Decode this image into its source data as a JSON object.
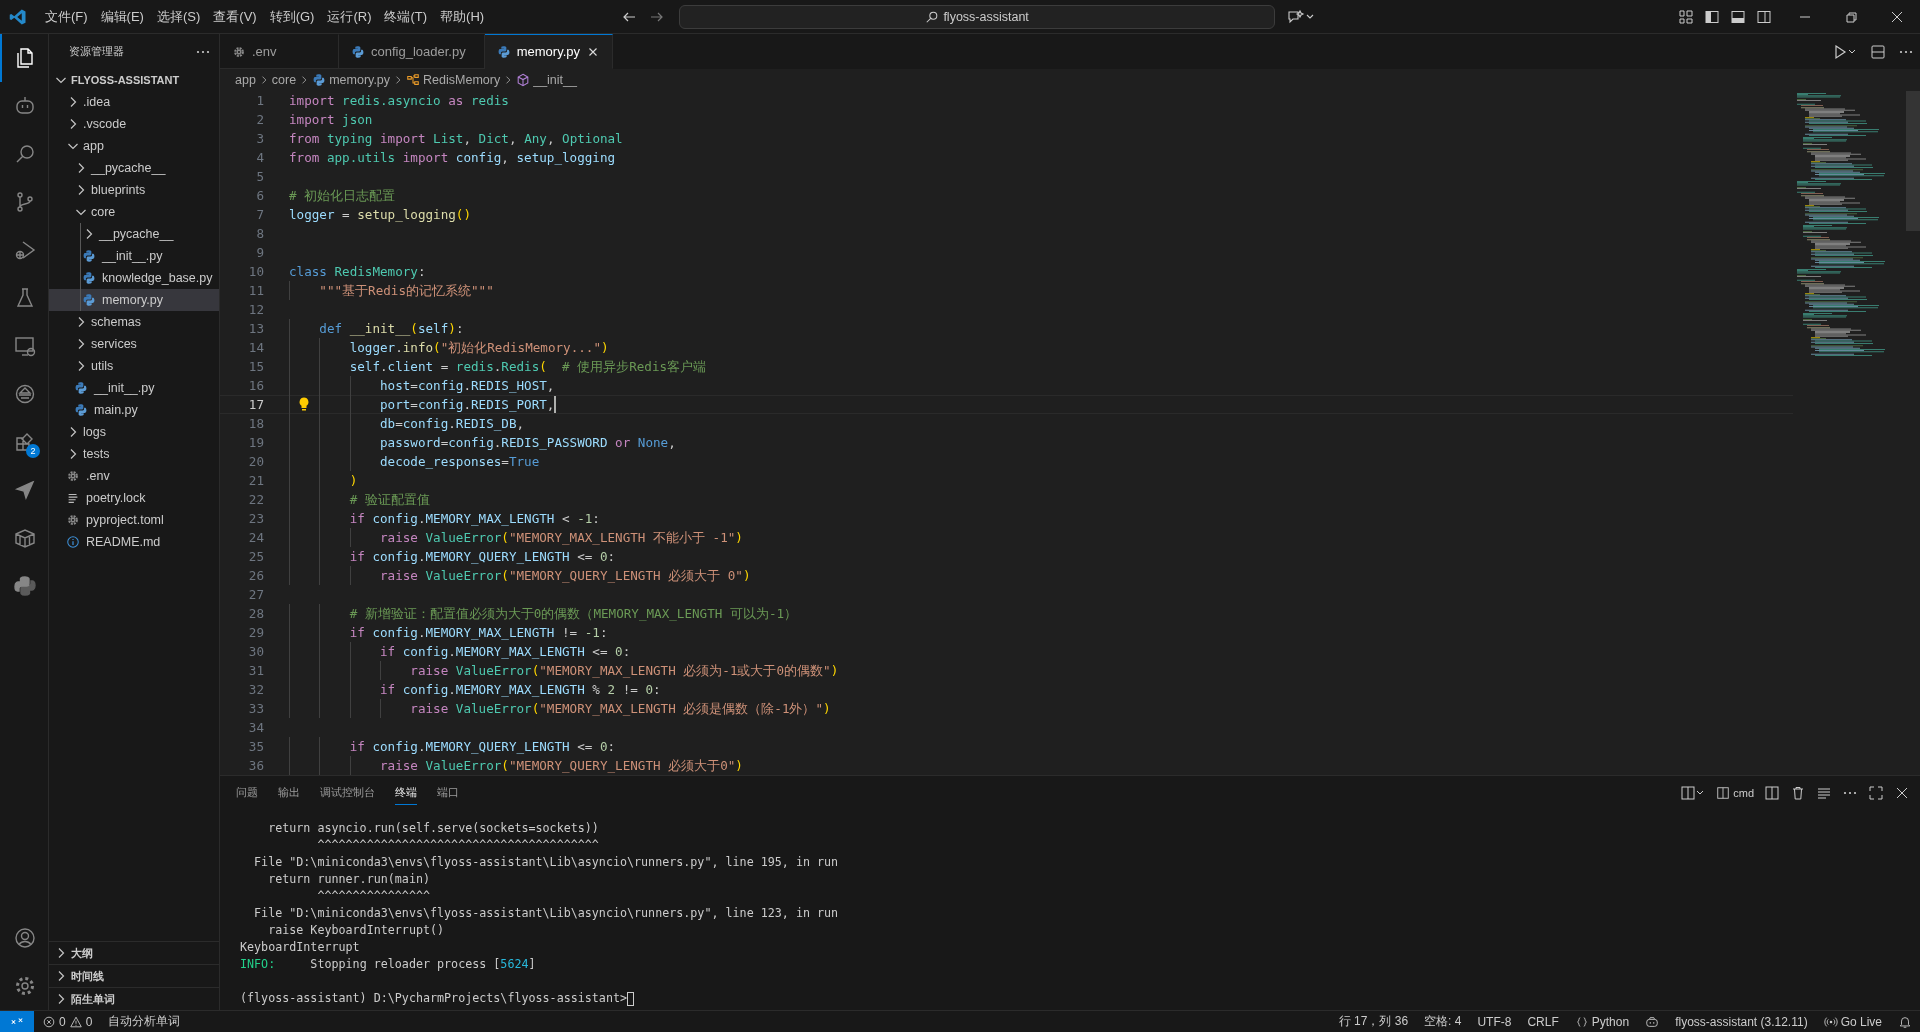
{
  "title_bar": {
    "menus": [
      "文件(F)",
      "编辑(E)",
      "选择(S)",
      "查看(V)",
      "转到(G)",
      "运行(R)",
      "终端(T)",
      "帮助(H)"
    ],
    "command_center": "flyoss-assistant"
  },
  "activity_bar": {
    "items": [
      {
        "kind": "files",
        "selected": true
      },
      {
        "kind": "robot",
        "selected": false
      },
      {
        "kind": "search",
        "selected": false
      },
      {
        "kind": "branch",
        "selected": false
      },
      {
        "kind": "debug",
        "selected": false
      },
      {
        "kind": "flask",
        "selected": false
      },
      {
        "kind": "monitor",
        "selected": false
      },
      {
        "kind": "dome",
        "selected": false
      },
      {
        "kind": "extensions",
        "selected": false,
        "badge": "2"
      },
      {
        "kind": "send",
        "selected": false
      },
      {
        "kind": "box",
        "selected": false
      },
      {
        "kind": "python",
        "selected": false
      }
    ],
    "bottom": [
      {
        "kind": "account",
        "selected": false
      },
      {
        "kind": "settings",
        "selected": false
      }
    ]
  },
  "sidebar": {
    "title": "资源管理器",
    "root": "FLYOSS-ASSISTANT",
    "items": [
      {
        "name": ".idea",
        "kind": "folder",
        "expanded": false,
        "selected": false
      },
      {
        "name": ".vscode",
        "kind": "folder",
        "expanded": false,
        "selected": false
      },
      {
        "name": "app",
        "kind": "folder",
        "expanded": true,
        "selected": false,
        "children": [
          {
            "name": "__pycache__",
            "kind": "folder",
            "expanded": false,
            "selected": false
          },
          {
            "name": "blueprints",
            "kind": "folder",
            "expanded": false,
            "selected": false
          },
          {
            "name": "core",
            "kind": "folder",
            "expanded": true,
            "selected": false,
            "children": [
              {
                "name": "__pycache__",
                "kind": "folder",
                "expanded": false,
                "selected": false
              },
              {
                "name": "__init__.py",
                "kind": "python",
                "selected": false
              },
              {
                "name": "knowledge_base.py",
                "kind": "python",
                "selected": false
              },
              {
                "name": "memory.py",
                "kind": "python",
                "selected": true
              }
            ]
          },
          {
            "name": "schemas",
            "kind": "folder",
            "expanded": false,
            "selected": false
          },
          {
            "name": "services",
            "kind": "folder",
            "expanded": false,
            "selected": false
          },
          {
            "name": "utils",
            "kind": "folder",
            "expanded": false,
            "selected": false
          },
          {
            "name": "__init__.py",
            "kind": "python",
            "selected": false
          },
          {
            "name": "main.py",
            "kind": "python",
            "selected": false
          }
        ]
      },
      {
        "name": "logs",
        "kind": "folder",
        "expanded": false,
        "selected": false
      },
      {
        "name": "tests",
        "kind": "folder",
        "expanded": false,
        "selected": false
      },
      {
        "name": ".env",
        "kind": "gear",
        "selected": false
      },
      {
        "name": "poetry.lock",
        "kind": "lines",
        "selected": false
      },
      {
        "name": "pyproject.toml",
        "kind": "gear",
        "selected": false
      },
      {
        "name": "README.md",
        "kind": "info",
        "selected": false
      }
    ],
    "sections": [
      {
        "label": "大纲",
        "expanded": false
      },
      {
        "label": "时间线",
        "expanded": false
      },
      {
        "label": "陌生单词",
        "expanded": false
      }
    ]
  },
  "tabs": [
    {
      "label": ".env",
      "kind": "gear",
      "selected": false
    },
    {
      "label": "config_loader.py",
      "kind": "python",
      "selected": false
    },
    {
      "label": "memory.py",
      "kind": "python",
      "selected": true
    }
  ],
  "breadcrumbs": [
    {
      "label": "app",
      "kind": "folder"
    },
    {
      "label": "core",
      "kind": "folder"
    },
    {
      "label": "memory.py",
      "kind": "python"
    },
    {
      "label": "RedisMemory",
      "kind": "class"
    },
    {
      "label": "__init__",
      "kind": "method"
    }
  ],
  "code": [
    {
      "number": "1",
      "current": false,
      "tokens": [
        {
          "kind": "kw",
          "text": "import "
        },
        {
          "kind": "mod",
          "text": "redis.asyncio"
        },
        {
          "kind": "kw",
          "text": " as "
        },
        {
          "kind": "mod",
          "text": "redis"
        }
      ]
    },
    {
      "number": "2",
      "current": false,
      "tokens": [
        {
          "kind": "kw",
          "text": "import "
        },
        {
          "kind": "mod",
          "text": "json"
        }
      ]
    },
    {
      "number": "3",
      "current": false,
      "tokens": [
        {
          "kind": "kw",
          "text": "from "
        },
        {
          "kind": "mod",
          "text": "typing"
        },
        {
          "kind": "kw",
          "text": " import "
        },
        {
          "kind": "mod",
          "text": "List"
        },
        {
          "kind": "op",
          "text": ", "
        },
        {
          "kind": "mod",
          "text": "Dict"
        },
        {
          "kind": "op",
          "text": ", "
        },
        {
          "kind": "mod",
          "text": "Any"
        },
        {
          "kind": "op",
          "text": ", "
        },
        {
          "kind": "mod",
          "text": "Optional"
        }
      ]
    },
    {
      "number": "4",
      "current": false,
      "tokens": [
        {
          "kind": "kw",
          "text": "from "
        },
        {
          "kind": "mod",
          "text": "app.utils"
        },
        {
          "kind": "kw",
          "text": " import "
        },
        {
          "kind": "var",
          "text": "config"
        },
        {
          "kind": "op",
          "text": ", "
        },
        {
          "kind": "var",
          "text": "setup_logging"
        }
      ]
    },
    {
      "number": "5",
      "current": false
    },
    {
      "number": "6",
      "current": false,
      "tokens": [
        {
          "kind": "cm",
          "text": "# 初始化日志配置"
        }
      ]
    },
    {
      "number": "7",
      "current": false,
      "tokens": [
        {
          "kind": "var",
          "text": "logger"
        },
        {
          "kind": "op",
          "text": " = "
        },
        {
          "kind": "fn",
          "text": "setup_logging"
        },
        {
          "kind": "paren",
          "text": "()"
        }
      ]
    },
    {
      "number": "8",
      "current": false
    },
    {
      "number": "9",
      "current": false
    },
    {
      "number": "10",
      "current": false,
      "tokens": [
        {
          "kind": "sto",
          "text": "class "
        },
        {
          "kind": "mod",
          "text": "RedisMemory"
        },
        {
          "kind": "op",
          "text": ":"
        }
      ]
    },
    {
      "number": "11",
      "current": false,
      "tokens": [
        {
          "kind": "str",
          "text": "    \"\"\"基于Redis的记忆系统\"\"\""
        }
      ]
    },
    {
      "number": "12",
      "current": false
    },
    {
      "number": "13",
      "current": false,
      "tokens": [
        {
          "kind": "sto",
          "text": "    def "
        },
        {
          "kind": "fn",
          "text": "__init__"
        },
        {
          "kind": "paren",
          "text": "("
        },
        {
          "kind": "var",
          "text": "self"
        },
        {
          "kind": "paren",
          "text": ")"
        },
        {
          "kind": "op",
          "text": ":"
        }
      ]
    },
    {
      "number": "14",
      "current": false,
      "tokens": [
        {
          "kind": "var",
          "text": "        logger"
        },
        {
          "kind": "op",
          "text": "."
        },
        {
          "kind": "fn",
          "text": "info"
        },
        {
          "kind": "paren",
          "text": "("
        },
        {
          "kind": "str",
          "text": "\"初始化RedisMemory...\""
        },
        {
          "kind": "paren",
          "text": ")"
        }
      ]
    },
    {
      "number": "15",
      "current": false,
      "tokens": [
        {
          "kind": "var",
          "text": "        self"
        },
        {
          "kind": "op",
          "text": "."
        },
        {
          "kind": "var",
          "text": "client"
        },
        {
          "kind": "op",
          "text": " = "
        },
        {
          "kind": "mod",
          "text": "redis"
        },
        {
          "kind": "op",
          "text": "."
        },
        {
          "kind": "mod",
          "text": "Redis"
        },
        {
          "kind": "paren",
          "text": "("
        },
        {
          "kind": "cm",
          "text": "  # 使用异步Redis客户端"
        }
      ]
    },
    {
      "number": "16",
      "current": false,
      "tokens": [
        {
          "kind": "var",
          "text": "            host"
        },
        {
          "kind": "op",
          "text": "="
        },
        {
          "kind": "var",
          "text": "config"
        },
        {
          "kind": "op",
          "text": "."
        },
        {
          "kind": "var",
          "text": "REDIS_HOST"
        },
        {
          "kind": "op",
          "text": ","
        }
      ]
    },
    {
      "number": "17",
      "current": true,
      "tokens": [
        {
          "kind": "var",
          "text": "            port"
        },
        {
          "kind": "op",
          "text": "="
        },
        {
          "kind": "var",
          "text": "config"
        },
        {
          "kind": "op",
          "text": "."
        },
        {
          "kind": "var",
          "text": "REDIS_PORT"
        },
        {
          "kind": "op",
          "text": ","
        }
      ]
    },
    {
      "number": "18",
      "current": false,
      "tokens": [
        {
          "kind": "var",
          "text": "            db"
        },
        {
          "kind": "op",
          "text": "="
        },
        {
          "kind": "var",
          "text": "config"
        },
        {
          "kind": "op",
          "text": "."
        },
        {
          "kind": "var",
          "text": "REDIS_DB"
        },
        {
          "kind": "op",
          "text": ","
        }
      ]
    },
    {
      "number": "19",
      "current": false,
      "tokens": [
        {
          "kind": "var",
          "text": "            password"
        },
        {
          "kind": "op",
          "text": "="
        },
        {
          "kind": "var",
          "text": "config"
        },
        {
          "kind": "op",
          "text": "."
        },
        {
          "kind": "var",
          "text": "REDIS_PASSWORD"
        },
        {
          "kind": "kw",
          "text": " or "
        },
        {
          "kind": "sto",
          "text": "None"
        },
        {
          "kind": "op",
          "text": ","
        }
      ]
    },
    {
      "number": "20",
      "current": false,
      "tokens": [
        {
          "kind": "var",
          "text": "            decode_responses"
        },
        {
          "kind": "op",
          "text": "="
        },
        {
          "kind": "sto",
          "text": "True"
        }
      ]
    },
    {
      "number": "21",
      "current": false,
      "tokens": [
        {
          "kind": "paren",
          "text": "        )"
        }
      ]
    },
    {
      "number": "22",
      "current": false,
      "tokens": [
        {
          "kind": "cm",
          "text": "        # 验证配置值"
        }
      ]
    },
    {
      "number": "23",
      "current": false,
      "tokens": [
        {
          "kind": "kw",
          "text": "        if "
        },
        {
          "kind": "var",
          "text": "config"
        },
        {
          "kind": "op",
          "text": "."
        },
        {
          "kind": "var",
          "text": "MEMORY_MAX_LENGTH"
        },
        {
          "kind": "op",
          "text": " < "
        },
        {
          "kind": "num",
          "text": "-1"
        },
        {
          "kind": "op",
          "text": ":"
        }
      ]
    },
    {
      "number": "24",
      "current": false,
      "tokens": [
        {
          "kind": "kw",
          "text": "            raise "
        },
        {
          "kind": "mod",
          "text": "ValueError"
        },
        {
          "kind": "paren",
          "text": "("
        },
        {
          "kind": "str",
          "text": "\"MEMORY_MAX_LENGTH 不能小于 -1\""
        },
        {
          "kind": "paren",
          "text": ")"
        }
      ]
    },
    {
      "number": "25",
      "current": false,
      "tokens": [
        {
          "kind": "kw",
          "text": "        if "
        },
        {
          "kind": "var",
          "text": "config"
        },
        {
          "kind": "op",
          "text": "."
        },
        {
          "kind": "var",
          "text": "MEMORY_QUERY_LENGTH"
        },
        {
          "kind": "op",
          "text": " <= "
        },
        {
          "kind": "num",
          "text": "0"
        },
        {
          "kind": "op",
          "text": ":"
        }
      ]
    },
    {
      "number": "26",
      "current": false,
      "tokens": [
        {
          "kind": "kw",
          "text": "            raise "
        },
        {
          "kind": "mod",
          "text": "ValueError"
        },
        {
          "kind": "paren",
          "text": "("
        },
        {
          "kind": "str",
          "text": "\"MEMORY_QUERY_LENGTH 必须大于 0\""
        },
        {
          "kind": "paren",
          "text": ")"
        }
      ]
    },
    {
      "number": "27",
      "current": false
    },
    {
      "number": "28",
      "current": false,
      "tokens": [
        {
          "kind": "cm",
          "text": "        # 新增验证：配置值必须为大于0的偶数（MEMORY_MAX_LENGTH 可以为-1）"
        }
      ]
    },
    {
      "number": "29",
      "current": false,
      "tokens": [
        {
          "kind": "kw",
          "text": "        if "
        },
        {
          "kind": "var",
          "text": "config"
        },
        {
          "kind": "op",
          "text": "."
        },
        {
          "kind": "var",
          "text": "MEMORY_MAX_LENGTH"
        },
        {
          "kind": "op",
          "text": " != "
        },
        {
          "kind": "num",
          "text": "-1"
        },
        {
          "kind": "op",
          "text": ":"
        }
      ]
    },
    {
      "number": "30",
      "current": false,
      "tokens": [
        {
          "kind": "kw",
          "text": "            if "
        },
        {
          "kind": "var",
          "text": "config"
        },
        {
          "kind": "op",
          "text": "."
        },
        {
          "kind": "var",
          "text": "MEMORY_MAX_LENGTH"
        },
        {
          "kind": "op",
          "text": " <= "
        },
        {
          "kind": "num",
          "text": "0"
        },
        {
          "kind": "op",
          "text": ":"
        }
      ]
    },
    {
      "number": "31",
      "current": false,
      "tokens": [
        {
          "kind": "kw",
          "text": "                raise "
        },
        {
          "kind": "mod",
          "text": "ValueError"
        },
        {
          "kind": "paren",
          "text": "("
        },
        {
          "kind": "str",
          "text": "\"MEMORY_MAX_LENGTH 必须为-1或大于0的偶数\""
        },
        {
          "kind": "paren",
          "text": ")"
        }
      ]
    },
    {
      "number": "32",
      "current": false,
      "tokens": [
        {
          "kind": "kw",
          "text": "            if "
        },
        {
          "kind": "var",
          "text": "config"
        },
        {
          "kind": "op",
          "text": "."
        },
        {
          "kind": "var",
          "text": "MEMORY_MAX_LENGTH"
        },
        {
          "kind": "op",
          "text": " % "
        },
        {
          "kind": "num",
          "text": "2"
        },
        {
          "kind": "op",
          "text": " != "
        },
        {
          "kind": "num",
          "text": "0"
        },
        {
          "kind": "op",
          "text": ":"
        }
      ]
    },
    {
      "number": "33",
      "current": false,
      "tokens": [
        {
          "kind": "kw",
          "text": "                raise "
        },
        {
          "kind": "mod",
          "text": "ValueError"
        },
        {
          "kind": "paren",
          "text": "("
        },
        {
          "kind": "str",
          "text": "\"MEMORY_MAX_LENGTH 必须是偶数（除-1外）\""
        },
        {
          "kind": "paren",
          "text": ")"
        }
      ]
    },
    {
      "number": "34",
      "current": false
    },
    {
      "number": "35",
      "current": false,
      "tokens": [
        {
          "kind": "kw",
          "text": "        if "
        },
        {
          "kind": "var",
          "text": "config"
        },
        {
          "kind": "op",
          "text": "."
        },
        {
          "kind": "var",
          "text": "MEMORY_QUERY_LENGTH"
        },
        {
          "kind": "op",
          "text": " <= "
        },
        {
          "kind": "num",
          "text": "0"
        },
        {
          "kind": "op",
          "text": ":"
        }
      ]
    },
    {
      "number": "36",
      "current": false,
      "tokens": [
        {
          "kind": "kw",
          "text": "            raise "
        },
        {
          "kind": "mod",
          "text": "ValueError"
        },
        {
          "kind": "paren",
          "text": "("
        },
        {
          "kind": "str",
          "text": "\"MEMORY_QUERY_LENGTH 必须大于0\""
        },
        {
          "kind": "paren",
          "text": ")"
        }
      ]
    }
  ],
  "panel": {
    "tabs": [
      {
        "label": "问题",
        "selected": false
      },
      {
        "label": "输出",
        "selected": false
      },
      {
        "label": "调试控制台",
        "selected": false
      },
      {
        "label": "终端",
        "selected": true
      },
      {
        "label": "端口",
        "selected": false
      }
    ],
    "shell": "cmd",
    "terminal": [
      {
        "segments": [
          {
            "kind": "plain",
            "text": "    return asyncio.run(self.serve(sockets=sockets))"
          }
        ]
      },
      {
        "segments": [
          {
            "kind": "plain",
            "text": "           ^^^^^^^^^^^^^^^^^^^^^^^^^^^^^^^^^^^^^^^^"
          }
        ]
      },
      {
        "segments": [
          {
            "kind": "plain",
            "text": "  File \"D:\\miniconda3\\envs\\flyoss-assistant\\Lib\\asyncio\\runners.py\", line 195, in run"
          }
        ]
      },
      {
        "segments": [
          {
            "kind": "plain",
            "text": "    return runner.run(main)"
          }
        ]
      },
      {
        "segments": [
          {
            "kind": "plain",
            "text": "           ^^^^^^^^^^^^^^^^"
          }
        ]
      },
      {
        "segments": [
          {
            "kind": "plain",
            "text": "  File \"D:\\miniconda3\\envs\\flyoss-assistant\\Lib\\asyncio\\runners.py\", line 123, in run"
          }
        ]
      },
      {
        "segments": [
          {
            "kind": "plain",
            "text": "    raise KeyboardInterrupt()"
          }
        ]
      },
      {
        "segments": [
          {
            "kind": "plain",
            "text": "KeyboardInterrupt"
          }
        ]
      },
      {
        "segments": [
          {
            "kind": "info",
            "text": "INFO:"
          },
          {
            "kind": "plain",
            "text": "     Stopping reloader process ["
          },
          {
            "kind": "num",
            "text": "5624"
          },
          {
            "kind": "plain",
            "text": "]"
          }
        ]
      },
      {
        "segments": [
          {
            "kind": "plain",
            "text": "(flyoss-assistant) D:\\PycharmProjects\\flyoss-assistant>"
          }
        ],
        "cursor": true,
        "blank_before": true
      }
    ]
  },
  "status_bar": {
    "errors": "0",
    "warnings": "0",
    "left": [
      "自动分析单词"
    ],
    "right": [
      {
        "kind": "text",
        "text": "行 17，列 36"
      },
      {
        "kind": "text",
        "text": "空格: 4"
      },
      {
        "kind": "text",
        "text": "UTF-8"
      },
      {
        "kind": "text",
        "text": "CRLF"
      },
      {
        "kind": "language",
        "text": "Python"
      },
      {
        "kind": "copilot"
      },
      {
        "kind": "text",
        "text": "flyoss-assistant (3.12.11)"
      },
      {
        "kind": "live",
        "text": "Go Live"
      },
      {
        "kind": "bell"
      }
    ]
  }
}
